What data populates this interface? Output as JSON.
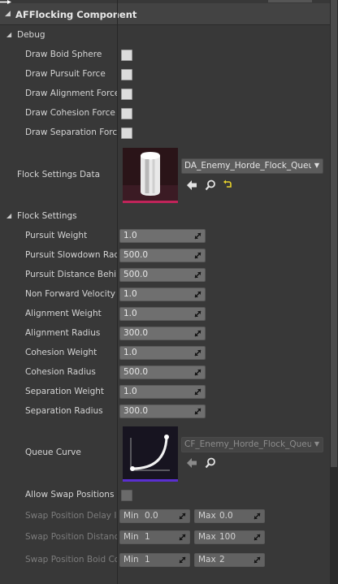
{
  "component_title": "AFFlocking Component",
  "debug": {
    "label": "Debug",
    "items": [
      {
        "label": "Draw Boid Sphere"
      },
      {
        "label": "Draw Pursuit Force"
      },
      {
        "label": "Draw Alignment Force"
      },
      {
        "label": "Draw Cohesion Force"
      },
      {
        "label": "Draw Separation Force"
      }
    ],
    "flock_settings_data": {
      "label": "Flock Settings Data",
      "asset": "DA_Enemy_Horde_Flock_Queue",
      "icons": [
        "use-selected-arrow-icon",
        "browse-magnifier-icon",
        "reset-arrow-icon"
      ]
    }
  },
  "flock_settings": {
    "label": "Flock Settings",
    "items": [
      {
        "label": "Pursuit Weight",
        "value": "1.0"
      },
      {
        "label": "Pursuit Slowdown Radi",
        "value": "500.0"
      },
      {
        "label": "Pursuit Distance Behin",
        "value": "500.0"
      },
      {
        "label": "Non Forward Velocity E",
        "value": "1.0"
      },
      {
        "label": "Alignment Weight",
        "value": "1.0"
      },
      {
        "label": "Alignment Radius",
        "value": "300.0"
      },
      {
        "label": "Cohesion Weight",
        "value": "1.0"
      },
      {
        "label": "Cohesion Radius",
        "value": "500.0"
      },
      {
        "label": "Separation Weight",
        "value": "1.0"
      },
      {
        "label": "Separation Radius",
        "value": "300.0"
      }
    ],
    "queue_curve": {
      "label": "Queue Curve",
      "asset": "CF_Enemy_Horde_Flock_Queue"
    },
    "allow_swap": {
      "label": "Allow Swap Positions"
    },
    "swap_ranges": [
      {
        "label": "Swap Position Delay In",
        "min_label": "Min",
        "min": "0.0",
        "max_label": "Max",
        "max": "0.0"
      },
      {
        "label": "Swap Position Distanc",
        "min_label": "Min",
        "min": "1",
        "max_label": "Max",
        "max": "100"
      },
      {
        "label": "Swap Position Boid Co",
        "min_label": "Min",
        "min": "1",
        "max_label": "Max",
        "max": "2"
      }
    ]
  },
  "colors": {
    "panel_bg": "#383838",
    "field_bg": "#6f6f6f",
    "asset_accent": "#c0245a",
    "curve_accent": "#5a2fd0"
  }
}
